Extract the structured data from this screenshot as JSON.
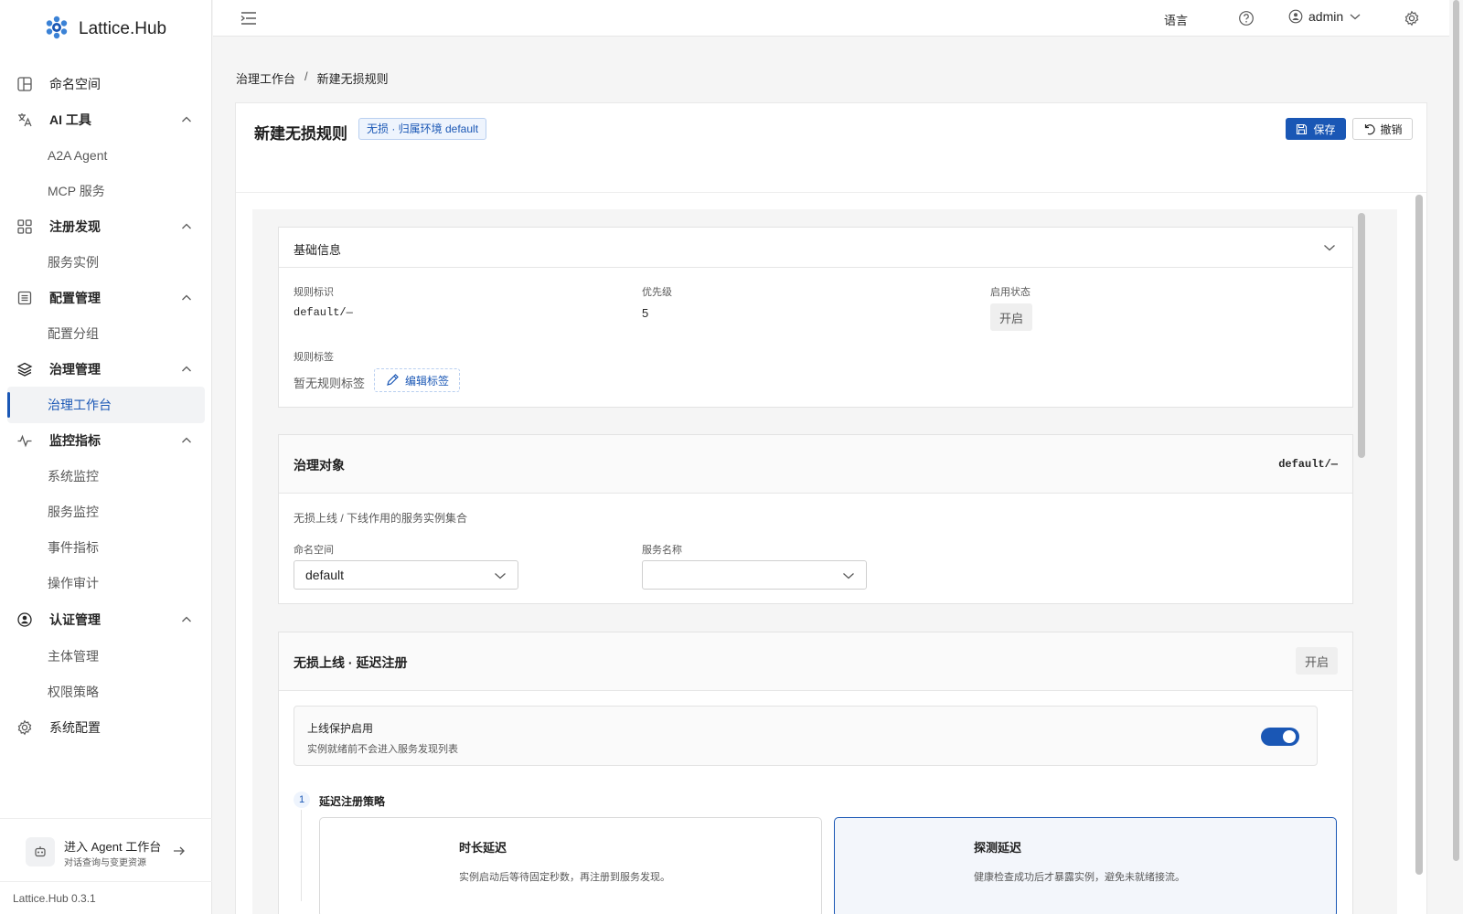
{
  "brand": {
    "title": "Lattice.Hub"
  },
  "sidebar": {
    "items": [
      {
        "label": "命名空间"
      },
      {
        "label": "AI 工具"
      },
      {
        "label": "A2A Agent"
      },
      {
        "label": "MCP 服务"
      },
      {
        "label": "注册发现"
      },
      {
        "label": "服务实例"
      },
      {
        "label": "配置管理"
      },
      {
        "label": "配置分组"
      },
      {
        "label": "治理管理"
      },
      {
        "label": "治理工作台"
      },
      {
        "label": "监控指标"
      },
      {
        "label": "系统监控"
      },
      {
        "label": "服务监控"
      },
      {
        "label": "事件指标"
      },
      {
        "label": "操作审计"
      },
      {
        "label": "认证管理"
      },
      {
        "label": "主体管理"
      },
      {
        "label": "权限策略"
      },
      {
        "label": "系统配置"
      }
    ],
    "agent_card": {
      "title": "进入 Agent 工作台",
      "subtitle": "对话查询与变更资源"
    },
    "version": "Lattice.Hub 0.3.1"
  },
  "header": {
    "language": "语言",
    "user": "admin"
  },
  "breadcrumb": {
    "parent": "治理工作台",
    "sep": "/",
    "current": "新建无损规则"
  },
  "page": {
    "title": "新建无损规则",
    "scope_tag": "无损 · 归属环境 default",
    "save_label": "保存",
    "undo_label": "撤销"
  },
  "basic_info": {
    "title": "基础信息",
    "rule_id_label": "规则标识",
    "rule_id_value": "default/—",
    "priority_label": "优先级",
    "priority_value": "5",
    "status_label": "启用状态",
    "status_value": "开启",
    "tags_label": "规则标签",
    "tags_empty": "暂无规则标签",
    "edit_tags": "编辑标签"
  },
  "target": {
    "title": "治理对象",
    "code": "default/—",
    "desc": "无损上线 / 下线作用的服务实例集合",
    "namespace_label": "命名空间",
    "namespace_value": "default",
    "service_label": "服务名称",
    "service_value": ""
  },
  "online": {
    "title": "无损上线 · 延迟注册",
    "status": "开启",
    "protect_title": "上线保护启用",
    "protect_desc": "实例就绪前不会进入服务发现列表",
    "protect_enabled": true,
    "step_number": "1",
    "step_title": "延迟注册策略",
    "options": [
      {
        "title": "时长延迟",
        "desc": "实例启动后等待固定秒数，再注册到服务发现。",
        "selected": false
      },
      {
        "title": "探测延迟",
        "desc": "健康检查成功后才暴露实例，避免未就绪接流。",
        "selected": true
      }
    ]
  },
  "colors": {
    "accent": "#1a57b5",
    "accent_bg": "#eef4fd"
  }
}
